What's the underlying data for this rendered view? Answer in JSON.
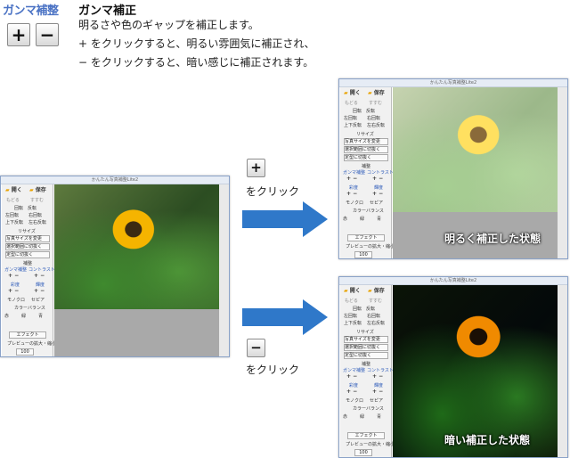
{
  "header": {
    "label": "ガンマ補整",
    "plus_symbol": "+",
    "minus_symbol": "−"
  },
  "description": {
    "title": "ガンマ補正",
    "lines": [
      "明るさや色のギャップを補正します。",
      "+ をクリックすると、明るい雰囲気に補正され、",
      "− をクリックすると、暗い感じに補正されます。"
    ]
  },
  "steps": [
    {
      "button_symbol": "+",
      "caption": "をクリック"
    },
    {
      "button_symbol": "−",
      "caption": "をクリック"
    }
  ],
  "app": {
    "title": "かんたん写真補整Lite2",
    "open": "開く",
    "save": "保存",
    "undo": "もどる",
    "redo": "すすむ",
    "rotate_label": "回転　反転",
    "rotate_left": "左回転",
    "rotate_right": "右回転",
    "flip_v": "上下反転",
    "flip_h": "左右反転",
    "resize_label": "リサイズ",
    "resize_btn": "写真サイズを変更",
    "crop_btn": "選択範囲に切抜く",
    "fixed_crop_btn": "定型に切抜く",
    "correction_label": "補整",
    "gamma": "ガンマ補整",
    "contrast": "コントラスト",
    "saturation": "彩度",
    "brightness": "輝度",
    "monochrome": "モノクロ",
    "sepia": "セピア",
    "color_balance_label": "カラーバランス",
    "red": "赤",
    "green": "緑",
    "blue": "青",
    "effect": "エフェクト",
    "preview_label": "プレビューの拡大・縮小",
    "zoom": "100"
  },
  "results": {
    "bright_label": "明るく補正した状態",
    "dark_label": "暗い補正した状態"
  },
  "colors": {
    "accent_blue": "#4a72c4",
    "arrow_blue": "#2f78c9"
  }
}
